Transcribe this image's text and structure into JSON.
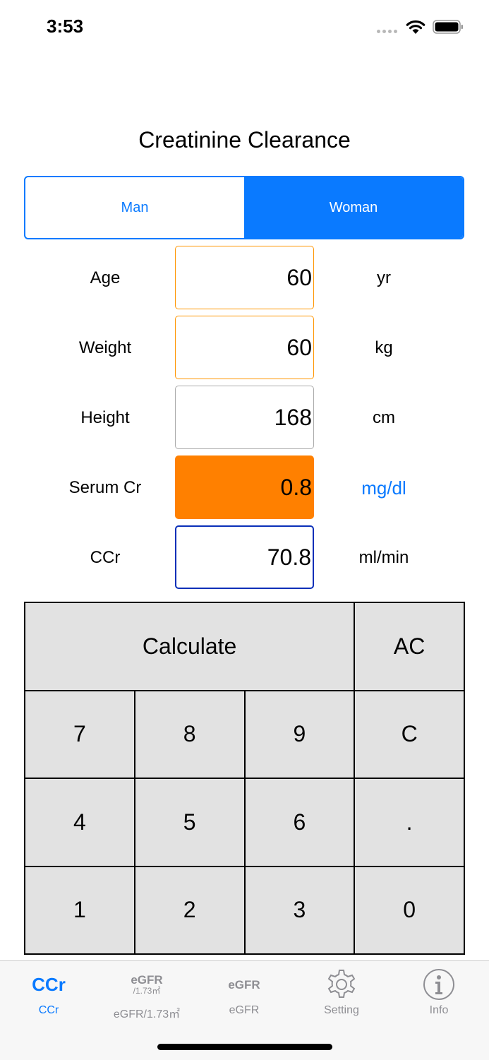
{
  "status_bar": {
    "time": "3:53"
  },
  "title": "Creatinine Clearance",
  "gender": {
    "options": [
      "Man",
      "Woman"
    ],
    "selected": "Woman"
  },
  "fields": {
    "age": {
      "label": "Age",
      "value": "60",
      "unit": "yr"
    },
    "weight": {
      "label": "Weight",
      "value": "60",
      "unit": "kg"
    },
    "height": {
      "label": "Height",
      "value": "168",
      "unit": "cm"
    },
    "serum_cr": {
      "label": "Serum Cr",
      "value": "0.8",
      "unit": "mg/dl"
    },
    "ccr": {
      "label": "CCr",
      "value": "70.8",
      "unit": "ml/min"
    }
  },
  "keypad": {
    "calculate": "Calculate",
    "ac": "AC",
    "clear": "C",
    "dot": ".",
    "digits": [
      "7",
      "8",
      "9",
      "4",
      "5",
      "6",
      "1",
      "2",
      "3",
      "0"
    ]
  },
  "tabs": [
    {
      "icon_text": "CCr",
      "label": "CCr",
      "active": true
    },
    {
      "icon_text": "eGFR",
      "icon_sub": "/1.73㎡",
      "label": "eGFR/1.73㎡",
      "active": false
    },
    {
      "icon_text": "eGFR",
      "label": "eGFR",
      "active": false
    },
    {
      "icon": "gear-icon",
      "label": "Setting",
      "active": false
    },
    {
      "icon": "info-icon",
      "label": "Info",
      "active": false
    }
  ],
  "colors": {
    "accent": "#0a7aff",
    "highlight_field": "#ff8000",
    "active_border": "#ff9500",
    "result_border": "#0a2fb8",
    "key_background": "#e2e2e2"
  }
}
